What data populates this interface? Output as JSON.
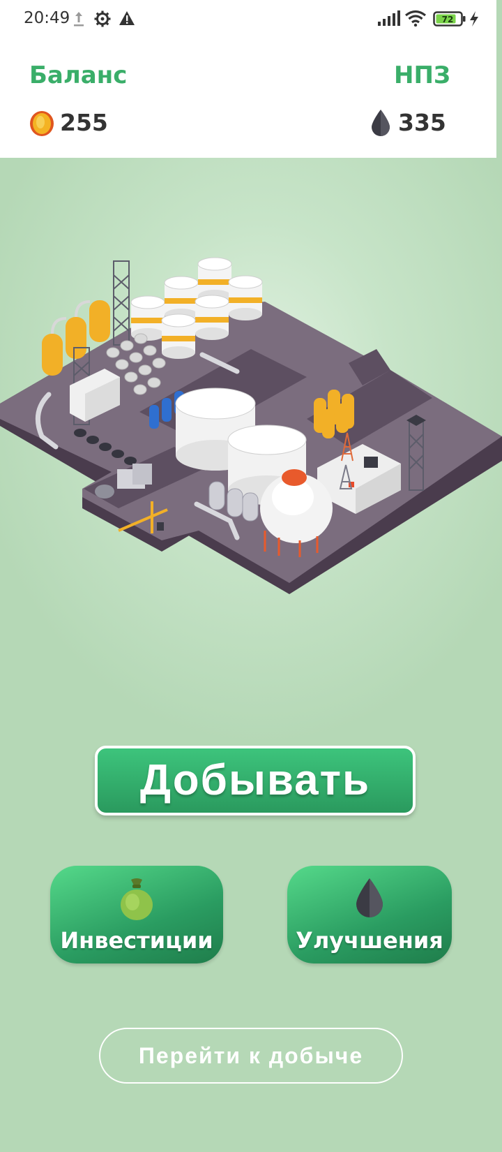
{
  "status_bar": {
    "time": "20:49",
    "battery_level": "72",
    "icons": [
      "upload-icon",
      "gear-icon",
      "warning-icon",
      "signal-icon",
      "wifi-icon",
      "battery-icon",
      "charging-icon"
    ]
  },
  "header": {
    "balance_label": "Баланс",
    "balance_value": "255",
    "refinery_label": "НПЗ",
    "refinery_value": "335"
  },
  "actions": {
    "mine_button": "Добывать",
    "investments_label": "Инвестиции",
    "upgrades_label": "Улучшения",
    "go_to_mining": "Перейти к добыче"
  },
  "colors": {
    "accent_green": "#3aae69",
    "button_green": "#2a9a5e",
    "background": "#c7e4c8",
    "coin": "#f2a21b",
    "oil": "#3b3b44"
  }
}
